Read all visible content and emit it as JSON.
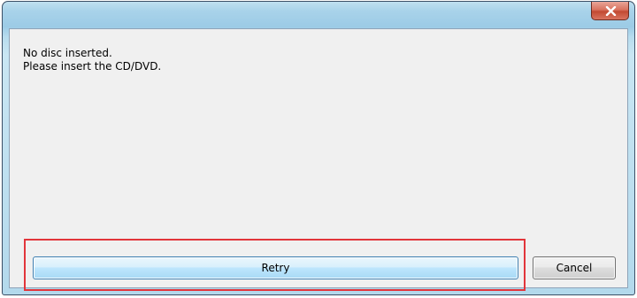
{
  "dialog": {
    "close_icon": "close-x-icon",
    "message_lines": [
      "No disc inserted.",
      "Please insert the CD/DVD."
    ],
    "retry_label": "Retry",
    "cancel_label": "Cancel"
  },
  "colors": {
    "highlight": "#e2353b",
    "close_button": "#c24a31",
    "retry_button_border": "#3c7fb1"
  }
}
